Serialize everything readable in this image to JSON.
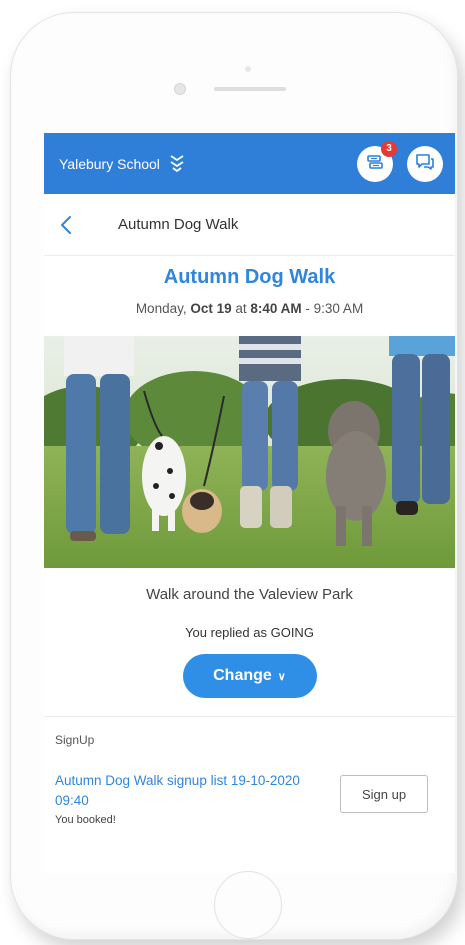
{
  "app": {
    "school_name": "Yalebury School",
    "notification_count": "3",
    "accent_color": "#2f7fd8",
    "icons": [
      "school-switch-icon",
      "notifications-icon",
      "messages-icon",
      "back-chevron-icon"
    ]
  },
  "nav": {
    "title": "Autumn Dog Walk"
  },
  "event": {
    "title": "Autumn Dog Walk",
    "date_prefix": "Monday, ",
    "date_day": "Oct 19",
    "date_at": " at ",
    "date_start": "8:40 AM",
    "date_range": " - 9:30 AM",
    "description": "Walk around the Valeview Park",
    "reply_text": "You replied as GOING",
    "change_label": "Change",
    "change_chevron": "∨"
  },
  "signup": {
    "heading": "SignUp",
    "list_title": "Autumn Dog Walk signup list 19-10-2020 09:40",
    "status": "You booked!",
    "button_label": "Sign up"
  }
}
